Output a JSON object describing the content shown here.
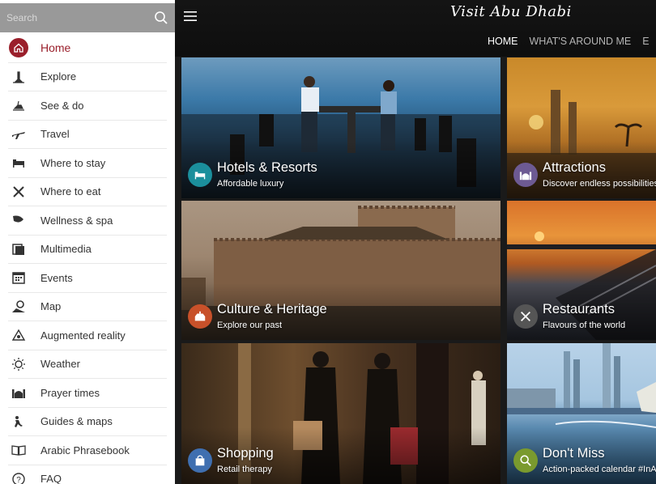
{
  "search": {
    "placeholder": "Search"
  },
  "sidebar": {
    "items": [
      {
        "label": "Home",
        "icon": "home-icon",
        "active": true
      },
      {
        "label": "Explore",
        "icon": "explore-icon"
      },
      {
        "label": "See & do",
        "icon": "see-do-icon"
      },
      {
        "label": "Travel",
        "icon": "airplane-icon"
      },
      {
        "label": "Where to stay",
        "icon": "bed-icon"
      },
      {
        "label": "Where to eat",
        "icon": "fork-knife-icon"
      },
      {
        "label": "Wellness & spa",
        "icon": "leaf-icon"
      },
      {
        "label": "Multimedia",
        "icon": "multimedia-icon"
      },
      {
        "label": "Events",
        "icon": "calendar-icon"
      },
      {
        "label": "Map",
        "icon": "map-icon"
      },
      {
        "label": "Augmented reality",
        "icon": "ar-icon"
      },
      {
        "label": "Weather",
        "icon": "sun-icon"
      },
      {
        "label": "Prayer times",
        "icon": "mosque-icon"
      },
      {
        "label": "Guides & maps",
        "icon": "guides-icon"
      },
      {
        "label": "Arabic Phrasebook",
        "icon": "book-icon"
      },
      {
        "label": "FAQ",
        "icon": "question-icon"
      }
    ]
  },
  "header": {
    "brand": "Visit Abu Dhabi",
    "tabs": [
      {
        "label": "HOME",
        "active": true
      },
      {
        "label": "WHAT'S AROUND ME"
      },
      {
        "label": "E"
      }
    ]
  },
  "tiles": [
    {
      "title": "Hotels & Resorts",
      "subtitle": "Affordable luxury",
      "icon": "bed-icon",
      "badge_color": "#1b8f9c"
    },
    {
      "title": "Attractions",
      "subtitle": "Discover endless possibilities",
      "icon": "mosque-icon",
      "badge_color": "#6d5a93"
    },
    {
      "title": "Culture & Heritage",
      "subtitle": "Explore our past",
      "icon": "fort-icon",
      "badge_color": "#c8512a"
    },
    {
      "title": "Restaurants",
      "subtitle": "Flavours of the world",
      "icon": "fork-knife-icon",
      "badge_color": "#555555"
    },
    {
      "title": "Shopping",
      "subtitle": "Retail therapy",
      "icon": "shopping-bag-icon",
      "badge_color": "#3f6fb0"
    },
    {
      "title": "Don't Miss",
      "subtitle": "Action-packed calendar #InAb",
      "icon": "magnifier-icon",
      "badge_color": "#7a9a2e"
    }
  ]
}
